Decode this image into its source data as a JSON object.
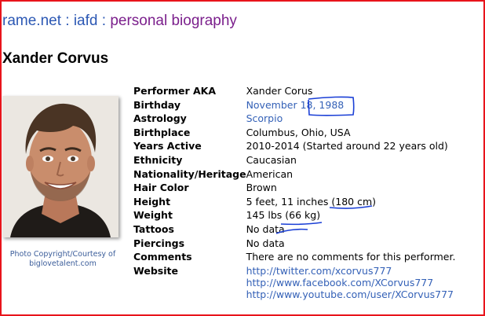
{
  "breadcrumb": {
    "site": "rame.net",
    "sep1": ":",
    "section": "iafd",
    "sep2": ":",
    "page": "personal biography"
  },
  "performer_name": "Xander Corvus",
  "photo": {
    "caption_line1": "Photo Copyright/Courtesy of",
    "caption_line2": "biglovetalent.com"
  },
  "details": [
    {
      "label": "Performer AKA",
      "value": "Xander Corus",
      "link": false
    },
    {
      "label": "Birthday",
      "value": "November 18, 1988",
      "link": true
    },
    {
      "label": "Astrology",
      "value": "Scorpio",
      "link": true
    },
    {
      "label": "Birthplace",
      "value": "Columbus, Ohio, USA",
      "link": false
    },
    {
      "label": "Years Active",
      "value": "2010-2014 (Started around 22 years old)",
      "link": false
    },
    {
      "label": "Ethnicity",
      "value": "Caucasian",
      "link": false
    },
    {
      "label": "Nationality/Heritage",
      "value": "American",
      "link": false
    },
    {
      "label": "Hair Color",
      "value": "Brown",
      "link": false
    },
    {
      "label": "Height",
      "value": "5 feet, 11 inches (180 cm)",
      "link": false
    },
    {
      "label": "Weight",
      "value": "145 lbs (66 kg)",
      "link": false
    },
    {
      "label": "Tattoos",
      "value": "No data",
      "link": false
    },
    {
      "label": "Piercings",
      "value": "No data",
      "link": false
    },
    {
      "label": "Comments",
      "value": "There are no comments for this performer.",
      "link": false
    }
  ],
  "website": {
    "label": "Website",
    "links": [
      "http://twitter.com/xcorvus777",
      "http://www.facebook.com/XCorvus777",
      "http://www.youtube.com/user/XCorvus777"
    ]
  },
  "colors": {
    "frame": "#e8141b",
    "link": "#3461b7",
    "visited": "#7b1f8c",
    "annotation": "#1a3fd6"
  }
}
